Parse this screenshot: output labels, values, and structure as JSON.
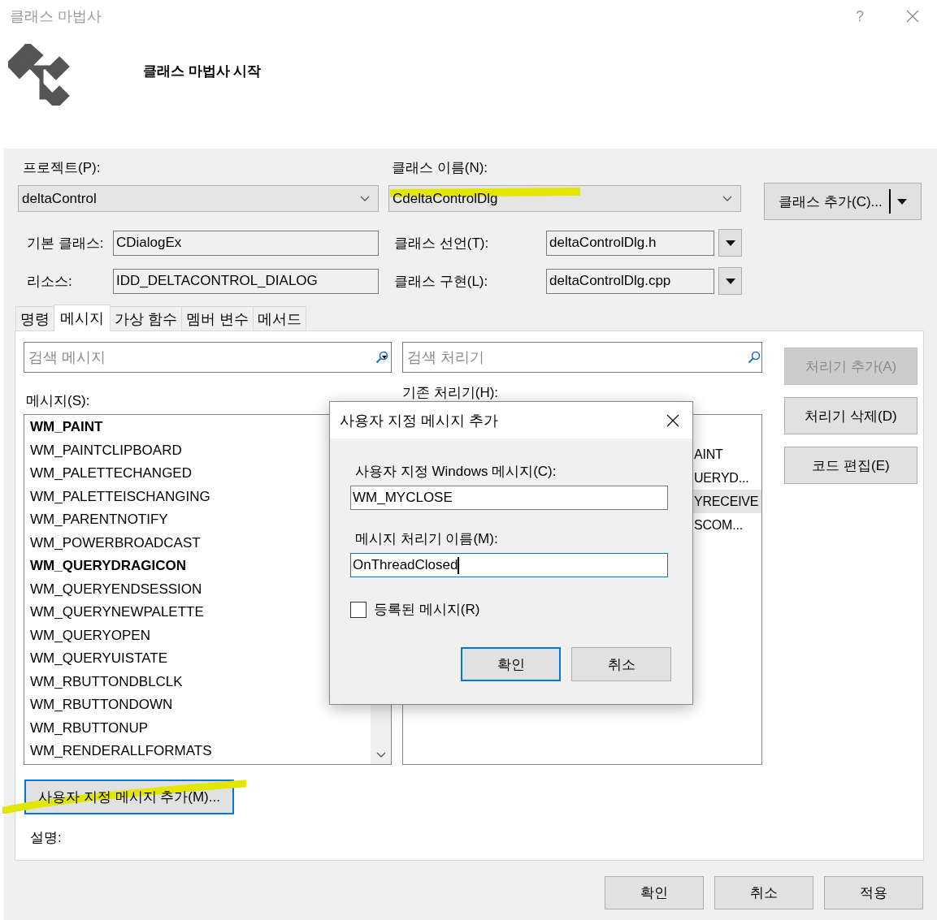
{
  "window": {
    "title": "클래스 마법사",
    "help": "?"
  },
  "header": {
    "heading": "클래스 마법사 시작"
  },
  "project": {
    "label": "프로젝트(P):",
    "value": "deltaControl"
  },
  "class_name": {
    "label": "클래스 이름(N):",
    "value": "CdeltaControlDlg"
  },
  "add_class_button": "클래스 추가(C)...",
  "base_class": {
    "label": "기본 클래스:",
    "value": "CDialogEx"
  },
  "class_declaration": {
    "label": "클래스 선언(T):",
    "value": "deltaControlDlg.h"
  },
  "resource": {
    "label": "리소스:",
    "value": "IDD_DELTACONTROL_DIALOG"
  },
  "class_implementation": {
    "label": "클래스 구현(L):",
    "value": "deltaControlDlg.cpp"
  },
  "tabs": [
    {
      "label": "명령",
      "selected": false
    },
    {
      "label": "메시지",
      "selected": true
    },
    {
      "label": "가상 함수",
      "selected": false
    },
    {
      "label": "멤버 변수",
      "selected": false
    },
    {
      "label": "메서드",
      "selected": false
    }
  ],
  "message_search": {
    "placeholder": "검색 메시지"
  },
  "handler_search": {
    "placeholder": "검색 처리기"
  },
  "messages": {
    "label": "메시지(S):",
    "items": [
      {
        "name": "WM_PAINT",
        "bold": true
      },
      {
        "name": "WM_PAINTCLIPBOARD",
        "bold": false
      },
      {
        "name": "WM_PALETTECHANGED",
        "bold": false
      },
      {
        "name": "WM_PALETTEISCHANGING",
        "bold": false
      },
      {
        "name": "WM_PARENTNOTIFY",
        "bold": false
      },
      {
        "name": "WM_POWERBROADCAST",
        "bold": false
      },
      {
        "name": "WM_QUERYDRAGICON",
        "bold": true
      },
      {
        "name": "WM_QUERYENDSESSION",
        "bold": false
      },
      {
        "name": "WM_QUERYNEWPALETTE",
        "bold": false
      },
      {
        "name": "WM_QUERYOPEN",
        "bold": false
      },
      {
        "name": "WM_QUERYUISTATE",
        "bold": false
      },
      {
        "name": "WM_RBUTTONDBLCLK",
        "bold": false
      },
      {
        "name": "WM_RBUTTONDOWN",
        "bold": false
      },
      {
        "name": "WM_RBUTTONUP",
        "bold": false
      },
      {
        "name": "WM_RENDERALLFORMATS",
        "bold": false
      }
    ]
  },
  "handlers": {
    "label": "기존 처리기(H):",
    "items": [
      {
        "text": "AINT",
        "selected": false
      },
      {
        "text": "UERYD...",
        "selected": false
      },
      {
        "text": "YRECEIVE",
        "selected": true
      },
      {
        "text": "SCOM...",
        "selected": false
      }
    ]
  },
  "side_buttons": [
    {
      "label": "처리기 추가(A)",
      "disabled": true
    },
    {
      "label": "처리기 삭제(D)",
      "disabled": false
    },
    {
      "label": "코드 편집(E)",
      "disabled": false
    }
  ],
  "add_custom_message_button": {
    "label": "사용자 지정 메시지 추가(M)...",
    "focused": true
  },
  "description_label": "설명:",
  "footer_buttons": [
    "확인",
    "취소",
    "적용"
  ],
  "modal": {
    "title": "사용자 지정 메시지 추가",
    "message_label": "사용자 지정 Windows 메시지(C):",
    "message_value": "WM_MYCLOSE",
    "handler_label": "메시지 처리기 이름(M):",
    "handler_value": "OnThreadClosed",
    "registered": {
      "label": "등록된 메시지(R)",
      "checked": false
    },
    "buttons": [
      {
        "label": "확인",
        "default": true
      },
      {
        "label": "취소",
        "default": false
      }
    ]
  }
}
